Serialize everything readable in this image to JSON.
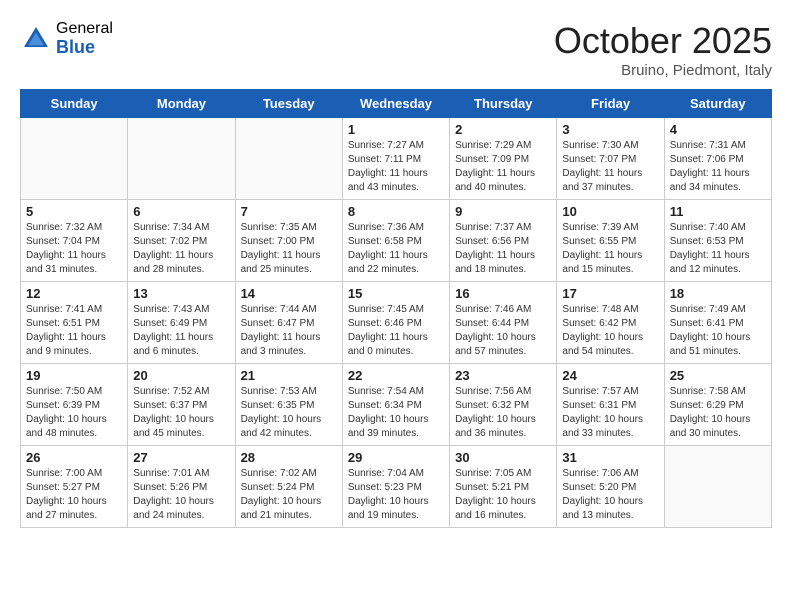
{
  "logo": {
    "general": "General",
    "blue": "Blue"
  },
  "title": "October 2025",
  "subtitle": "Bruino, Piedmont, Italy",
  "days": [
    "Sunday",
    "Monday",
    "Tuesday",
    "Wednesday",
    "Thursday",
    "Friday",
    "Saturday"
  ],
  "weeks": [
    [
      {
        "day": "",
        "info": ""
      },
      {
        "day": "",
        "info": ""
      },
      {
        "day": "",
        "info": ""
      },
      {
        "day": "1",
        "info": "Sunrise: 7:27 AM\nSunset: 7:11 PM\nDaylight: 11 hours\nand 43 minutes."
      },
      {
        "day": "2",
        "info": "Sunrise: 7:29 AM\nSunset: 7:09 PM\nDaylight: 11 hours\nand 40 minutes."
      },
      {
        "day": "3",
        "info": "Sunrise: 7:30 AM\nSunset: 7:07 PM\nDaylight: 11 hours\nand 37 minutes."
      },
      {
        "day": "4",
        "info": "Sunrise: 7:31 AM\nSunset: 7:06 PM\nDaylight: 11 hours\nand 34 minutes."
      }
    ],
    [
      {
        "day": "5",
        "info": "Sunrise: 7:32 AM\nSunset: 7:04 PM\nDaylight: 11 hours\nand 31 minutes."
      },
      {
        "day": "6",
        "info": "Sunrise: 7:34 AM\nSunset: 7:02 PM\nDaylight: 11 hours\nand 28 minutes."
      },
      {
        "day": "7",
        "info": "Sunrise: 7:35 AM\nSunset: 7:00 PM\nDaylight: 11 hours\nand 25 minutes."
      },
      {
        "day": "8",
        "info": "Sunrise: 7:36 AM\nSunset: 6:58 PM\nDaylight: 11 hours\nand 22 minutes."
      },
      {
        "day": "9",
        "info": "Sunrise: 7:37 AM\nSunset: 6:56 PM\nDaylight: 11 hours\nand 18 minutes."
      },
      {
        "day": "10",
        "info": "Sunrise: 7:39 AM\nSunset: 6:55 PM\nDaylight: 11 hours\nand 15 minutes."
      },
      {
        "day": "11",
        "info": "Sunrise: 7:40 AM\nSunset: 6:53 PM\nDaylight: 11 hours\nand 12 minutes."
      }
    ],
    [
      {
        "day": "12",
        "info": "Sunrise: 7:41 AM\nSunset: 6:51 PM\nDaylight: 11 hours\nand 9 minutes."
      },
      {
        "day": "13",
        "info": "Sunrise: 7:43 AM\nSunset: 6:49 PM\nDaylight: 11 hours\nand 6 minutes."
      },
      {
        "day": "14",
        "info": "Sunrise: 7:44 AM\nSunset: 6:47 PM\nDaylight: 11 hours\nand 3 minutes."
      },
      {
        "day": "15",
        "info": "Sunrise: 7:45 AM\nSunset: 6:46 PM\nDaylight: 11 hours\nand 0 minutes."
      },
      {
        "day": "16",
        "info": "Sunrise: 7:46 AM\nSunset: 6:44 PM\nDaylight: 10 hours\nand 57 minutes."
      },
      {
        "day": "17",
        "info": "Sunrise: 7:48 AM\nSunset: 6:42 PM\nDaylight: 10 hours\nand 54 minutes."
      },
      {
        "day": "18",
        "info": "Sunrise: 7:49 AM\nSunset: 6:41 PM\nDaylight: 10 hours\nand 51 minutes."
      }
    ],
    [
      {
        "day": "19",
        "info": "Sunrise: 7:50 AM\nSunset: 6:39 PM\nDaylight: 10 hours\nand 48 minutes."
      },
      {
        "day": "20",
        "info": "Sunrise: 7:52 AM\nSunset: 6:37 PM\nDaylight: 10 hours\nand 45 minutes."
      },
      {
        "day": "21",
        "info": "Sunrise: 7:53 AM\nSunset: 6:35 PM\nDaylight: 10 hours\nand 42 minutes."
      },
      {
        "day": "22",
        "info": "Sunrise: 7:54 AM\nSunset: 6:34 PM\nDaylight: 10 hours\nand 39 minutes."
      },
      {
        "day": "23",
        "info": "Sunrise: 7:56 AM\nSunset: 6:32 PM\nDaylight: 10 hours\nand 36 minutes."
      },
      {
        "day": "24",
        "info": "Sunrise: 7:57 AM\nSunset: 6:31 PM\nDaylight: 10 hours\nand 33 minutes."
      },
      {
        "day": "25",
        "info": "Sunrise: 7:58 AM\nSunset: 6:29 PM\nDaylight: 10 hours\nand 30 minutes."
      }
    ],
    [
      {
        "day": "26",
        "info": "Sunrise: 7:00 AM\nSunset: 5:27 PM\nDaylight: 10 hours\nand 27 minutes."
      },
      {
        "day": "27",
        "info": "Sunrise: 7:01 AM\nSunset: 5:26 PM\nDaylight: 10 hours\nand 24 minutes."
      },
      {
        "day": "28",
        "info": "Sunrise: 7:02 AM\nSunset: 5:24 PM\nDaylight: 10 hours\nand 21 minutes."
      },
      {
        "day": "29",
        "info": "Sunrise: 7:04 AM\nSunset: 5:23 PM\nDaylight: 10 hours\nand 19 minutes."
      },
      {
        "day": "30",
        "info": "Sunrise: 7:05 AM\nSunset: 5:21 PM\nDaylight: 10 hours\nand 16 minutes."
      },
      {
        "day": "31",
        "info": "Sunrise: 7:06 AM\nSunset: 5:20 PM\nDaylight: 10 hours\nand 13 minutes."
      },
      {
        "day": "",
        "info": ""
      }
    ]
  ]
}
